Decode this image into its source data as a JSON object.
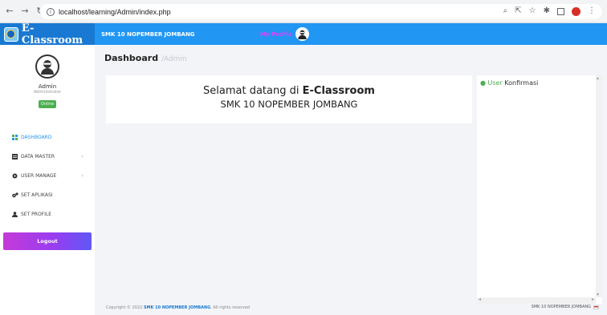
{
  "browser": {
    "url": "localhost/learning/Admin/index.php"
  },
  "topbar": {
    "brand": "E-Classroom",
    "school": "SMK 10 NOPEMBER JOMBANG",
    "my_profile": "My Profile"
  },
  "sidebar": {
    "name": "Admin",
    "role": "Administrator",
    "status": "Online",
    "items": [
      {
        "label": "DASHBOARD",
        "icon": "dashboard-icon"
      },
      {
        "label": "DATA MASTER",
        "icon": "database-icon"
      },
      {
        "label": "USER MANAGE",
        "icon": "users-cog-icon"
      },
      {
        "label": "SET APLIKASI",
        "icon": "cogs-icon"
      },
      {
        "label": "SET PROFILE",
        "icon": "user-icon"
      }
    ],
    "logout": "Logout"
  },
  "main": {
    "title": "Dashboard",
    "subtitle": "/Admin",
    "welcome_prefix": "Selamat datang di ",
    "welcome_brand": "E-Classroom",
    "welcome_school": "SMK 10 NOPEMBER JOMBANG",
    "confirm_title_green": "User",
    "confirm_title_rest": " Konfirmasi"
  },
  "footer": {
    "copyright_prefix": "Copyright © 2022 ",
    "copyright_school": "SMK 10 NOPEMBER JOMBANG",
    "copyright_suffix": ". All rights reserved",
    "right": "SMK 10 NOPEMBER JOMBANG"
  },
  "colors": {
    "navbar": "#2196f3",
    "brand_bg": "#1979d2",
    "active": "#2196f3",
    "online": "#4caf50"
  }
}
